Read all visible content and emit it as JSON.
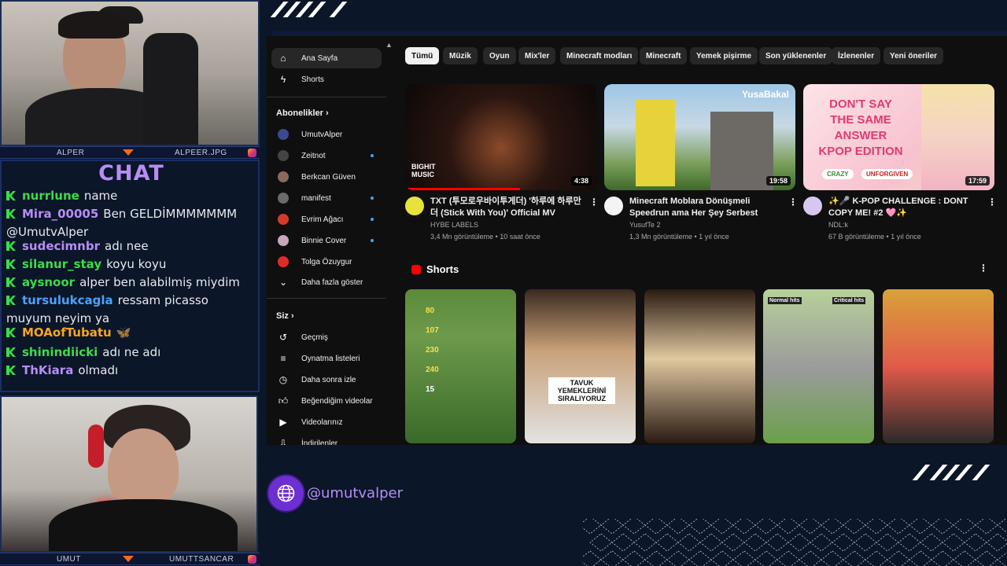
{
  "cams": {
    "top": {
      "left_name": "ALPER",
      "right_name": "ALPEER.JPG"
    },
    "bottom": {
      "left_name": "UMUT",
      "right_name": "UMUTTSANCAR"
    }
  },
  "chat": {
    "title": "CHAT",
    "messages": [
      {
        "user": "nurrlune",
        "text": "name",
        "color": "#3bdc4a"
      },
      {
        "user": "Mira_00005",
        "text": "Ben GELDİMMMMMMM @UmutvAlper",
        "color": "#b78df5"
      },
      {
        "user": "sudecimnbr",
        "text": "adı nee",
        "color": "#b78df5"
      },
      {
        "user": "silanur_stay",
        "text": "koyu koyu",
        "color": "#3bdc4a"
      },
      {
        "user": "aysnoor",
        "text": "alper ben alabilmiş miydim",
        "color": "#3bdc4a"
      },
      {
        "user": "tursulukcagla",
        "text": "ressam picasso muyum neyim ya",
        "color": "#4aa3ff"
      },
      {
        "user": "MOAofTubatu",
        "text": "🦋",
        "color": "#f5a623"
      },
      {
        "user": "shinindiicki",
        "text": "adı ne adı",
        "color": "#3bdc4a"
      },
      {
        "user": "ThKiara",
        "text": "olmadı",
        "color": "#b78df5"
      }
    ]
  },
  "youtube": {
    "sidebar": {
      "main": [
        {
          "label": "Ana Sayfa",
          "icon": "home-icon",
          "active": true
        },
        {
          "label": "Shorts",
          "icon": "shorts-icon",
          "active": false
        }
      ],
      "subscriptions_heading": "Abonelikler",
      "subscriptions": [
        {
          "label": "UmutvAlper",
          "color": "#3b4a8a",
          "dot": false
        },
        {
          "label": "Zeitnot",
          "color": "#444444",
          "dot": true
        },
        {
          "label": "Berkcan Güven",
          "color": "#8a6a5a",
          "dot": false
        },
        {
          "label": "manifest",
          "color": "#6a6a6a",
          "dot": true
        },
        {
          "label": "Evrim Ağacı",
          "color": "#d23b2b",
          "dot": true
        },
        {
          "label": "Binnie Cover",
          "color": "#c9a7b9",
          "dot": true
        },
        {
          "label": "Tolga Özuygur",
          "color": "#e02b2b",
          "dot": false
        }
      ],
      "show_more": "Daha fazla göster",
      "you_heading": "Siz",
      "you_items": [
        {
          "label": "Geçmiş",
          "icon": "history-icon"
        },
        {
          "label": "Oynatma listeleri",
          "icon": "playlists-icon"
        },
        {
          "label": "Daha sonra izle",
          "icon": "watch-later-icon"
        },
        {
          "label": "Beğendiğim videolar",
          "icon": "like-icon"
        },
        {
          "label": "Videolarınız",
          "icon": "your-videos-icon"
        },
        {
          "label": "İndirilenler",
          "icon": "downloads-icon"
        }
      ]
    },
    "chips": [
      "Tümü",
      "Müzik",
      "Oyun",
      "Mix'ler",
      "Minecraft modları",
      "Minecraft",
      "Yemek pişirme",
      "Son yüklenenler",
      "İzlenenler",
      "Yeni öneriler"
    ],
    "videos": [
      {
        "title": "TXT (투모로우바이투게더) '하루에 하루만 더 (Stick With You)' Official MV",
        "channel": "HYBE LABELS",
        "meta": "3,4 Mn görüntüleme • 10 saat önce",
        "duration": "4:38",
        "thumb_text": "BIGHIT MUSIC"
      },
      {
        "title": "Minecraft Moblara Dönüşmeli Speedrun ama Her Şey Serbest",
        "channel": "YusufTe 2",
        "meta": "1,3 Mn görüntüleme • 1 yıl önce",
        "duration": "19:58",
        "thumb_text": "YusaBakal"
      },
      {
        "title": "✨🎤 K-POP CHALLENGE : DONT COPY ME! #2 🩷✨",
        "channel": "NDL:k",
        "meta": "67 B görüntüleme • 1 yıl önce",
        "duration": "17:59",
        "thumb_text": "DON'T SAY THE SAME ANSWER KPOP EDITION",
        "tag1": "CRAZY",
        "tag2": "UNFORGIVEN"
      }
    ],
    "shorts_heading": "Shorts",
    "shorts": [
      {
        "labels": [
          "80",
          "107",
          "230",
          "240",
          "15"
        ]
      },
      {
        "labels": [
          "TAVUK YEMEKLERİNİ SIRALIYORUZ"
        ]
      },
      {
        "labels": []
      },
      {
        "labels": [
          "Normal hits",
          "Critical hits"
        ]
      },
      {
        "labels": []
      }
    ]
  },
  "handle": "@umutvalper"
}
